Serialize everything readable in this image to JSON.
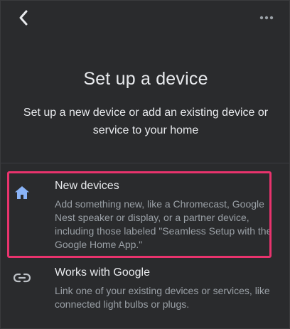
{
  "nav": {
    "back_icon": "chevron-left-icon",
    "more_icon": "more-horizontal-icon"
  },
  "header": {
    "title": "Set up a device",
    "subtitle": "Set up a new device or add an existing device or service to your home"
  },
  "options": [
    {
      "icon": "home-icon",
      "label": "New devices",
      "description": "Add something new, like a Chromecast, Google Nest speaker or display, or a partner device, including those labeled \"Seamless Setup with the Google Home App.\""
    },
    {
      "icon": "link-icon",
      "label": "Works with Google",
      "description": "Link one of your existing devices or services, like connected light bulbs or plugs."
    }
  ],
  "colors": {
    "background": "#2a2b2d",
    "primary_text": "#e8eaed",
    "secondary_text": "#9aa0a6",
    "home_icon": "#8ab4f8",
    "highlight_border": "#e8336d"
  }
}
